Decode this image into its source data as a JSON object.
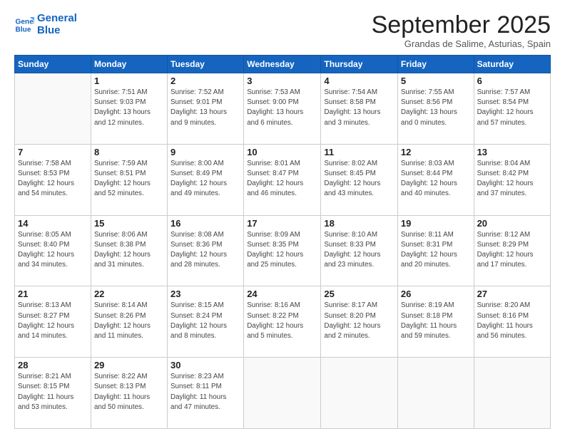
{
  "logo": {
    "line1": "General",
    "line2": "Blue"
  },
  "title": "September 2025",
  "location": "Grandas de Salime, Asturias, Spain",
  "weekdays": [
    "Sunday",
    "Monday",
    "Tuesday",
    "Wednesday",
    "Thursday",
    "Friday",
    "Saturday"
  ],
  "weeks": [
    [
      {
        "day": "",
        "info": ""
      },
      {
        "day": "1",
        "info": "Sunrise: 7:51 AM\nSunset: 9:03 PM\nDaylight: 13 hours\nand 12 minutes."
      },
      {
        "day": "2",
        "info": "Sunrise: 7:52 AM\nSunset: 9:01 PM\nDaylight: 13 hours\nand 9 minutes."
      },
      {
        "day": "3",
        "info": "Sunrise: 7:53 AM\nSunset: 9:00 PM\nDaylight: 13 hours\nand 6 minutes."
      },
      {
        "day": "4",
        "info": "Sunrise: 7:54 AM\nSunset: 8:58 PM\nDaylight: 13 hours\nand 3 minutes."
      },
      {
        "day": "5",
        "info": "Sunrise: 7:55 AM\nSunset: 8:56 PM\nDaylight: 13 hours\nand 0 minutes."
      },
      {
        "day": "6",
        "info": "Sunrise: 7:57 AM\nSunset: 8:54 PM\nDaylight: 12 hours\nand 57 minutes."
      }
    ],
    [
      {
        "day": "7",
        "info": "Sunrise: 7:58 AM\nSunset: 8:53 PM\nDaylight: 12 hours\nand 54 minutes."
      },
      {
        "day": "8",
        "info": "Sunrise: 7:59 AM\nSunset: 8:51 PM\nDaylight: 12 hours\nand 52 minutes."
      },
      {
        "day": "9",
        "info": "Sunrise: 8:00 AM\nSunset: 8:49 PM\nDaylight: 12 hours\nand 49 minutes."
      },
      {
        "day": "10",
        "info": "Sunrise: 8:01 AM\nSunset: 8:47 PM\nDaylight: 12 hours\nand 46 minutes."
      },
      {
        "day": "11",
        "info": "Sunrise: 8:02 AM\nSunset: 8:45 PM\nDaylight: 12 hours\nand 43 minutes."
      },
      {
        "day": "12",
        "info": "Sunrise: 8:03 AM\nSunset: 8:44 PM\nDaylight: 12 hours\nand 40 minutes."
      },
      {
        "day": "13",
        "info": "Sunrise: 8:04 AM\nSunset: 8:42 PM\nDaylight: 12 hours\nand 37 minutes."
      }
    ],
    [
      {
        "day": "14",
        "info": "Sunrise: 8:05 AM\nSunset: 8:40 PM\nDaylight: 12 hours\nand 34 minutes."
      },
      {
        "day": "15",
        "info": "Sunrise: 8:06 AM\nSunset: 8:38 PM\nDaylight: 12 hours\nand 31 minutes."
      },
      {
        "day": "16",
        "info": "Sunrise: 8:08 AM\nSunset: 8:36 PM\nDaylight: 12 hours\nand 28 minutes."
      },
      {
        "day": "17",
        "info": "Sunrise: 8:09 AM\nSunset: 8:35 PM\nDaylight: 12 hours\nand 25 minutes."
      },
      {
        "day": "18",
        "info": "Sunrise: 8:10 AM\nSunset: 8:33 PM\nDaylight: 12 hours\nand 23 minutes."
      },
      {
        "day": "19",
        "info": "Sunrise: 8:11 AM\nSunset: 8:31 PM\nDaylight: 12 hours\nand 20 minutes."
      },
      {
        "day": "20",
        "info": "Sunrise: 8:12 AM\nSunset: 8:29 PM\nDaylight: 12 hours\nand 17 minutes."
      }
    ],
    [
      {
        "day": "21",
        "info": "Sunrise: 8:13 AM\nSunset: 8:27 PM\nDaylight: 12 hours\nand 14 minutes."
      },
      {
        "day": "22",
        "info": "Sunrise: 8:14 AM\nSunset: 8:26 PM\nDaylight: 12 hours\nand 11 minutes."
      },
      {
        "day": "23",
        "info": "Sunrise: 8:15 AM\nSunset: 8:24 PM\nDaylight: 12 hours\nand 8 minutes."
      },
      {
        "day": "24",
        "info": "Sunrise: 8:16 AM\nSunset: 8:22 PM\nDaylight: 12 hours\nand 5 minutes."
      },
      {
        "day": "25",
        "info": "Sunrise: 8:17 AM\nSunset: 8:20 PM\nDaylight: 12 hours\nand 2 minutes."
      },
      {
        "day": "26",
        "info": "Sunrise: 8:19 AM\nSunset: 8:18 PM\nDaylight: 11 hours\nand 59 minutes."
      },
      {
        "day": "27",
        "info": "Sunrise: 8:20 AM\nSunset: 8:16 PM\nDaylight: 11 hours\nand 56 minutes."
      }
    ],
    [
      {
        "day": "28",
        "info": "Sunrise: 8:21 AM\nSunset: 8:15 PM\nDaylight: 11 hours\nand 53 minutes."
      },
      {
        "day": "29",
        "info": "Sunrise: 8:22 AM\nSunset: 8:13 PM\nDaylight: 11 hours\nand 50 minutes."
      },
      {
        "day": "30",
        "info": "Sunrise: 8:23 AM\nSunset: 8:11 PM\nDaylight: 11 hours\nand 47 minutes."
      },
      {
        "day": "",
        "info": ""
      },
      {
        "day": "",
        "info": ""
      },
      {
        "day": "",
        "info": ""
      },
      {
        "day": "",
        "info": ""
      }
    ]
  ]
}
